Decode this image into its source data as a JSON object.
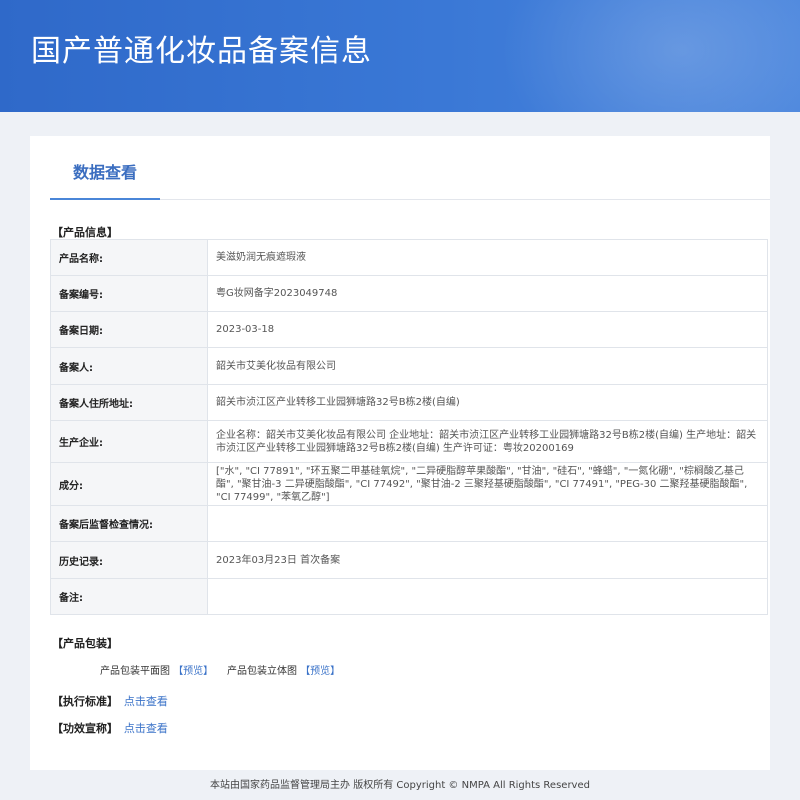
{
  "header": {
    "title": "国产普通化妆品备案信息"
  },
  "tabs": [
    {
      "label": "数据查看"
    }
  ],
  "product_info": {
    "section_title": "【产品信息】",
    "rows": [
      {
        "label": "产品名称:",
        "value": "美滋奶润无痕遮瑕液"
      },
      {
        "label": "备案编号:",
        "value": "粤G妆网备字2023049748"
      },
      {
        "label": "备案日期:",
        "value": "2023-03-18"
      },
      {
        "label": "备案人:",
        "value": "韶关市艾美化妆品有限公司"
      },
      {
        "label": "备案人住所地址:",
        "value": "韶关市浈江区产业转移工业园狮塘路32号B栋2楼(自编)"
      },
      {
        "label": "生产企业:",
        "value": "企业名称：韶关市艾美化妆品有限公司 企业地址：韶关市浈江区产业转移工业园狮塘路32号B栋2楼(自编) 生产地址：韶关市浈江区产业转移工业园狮塘路32号B栋2楼(自编) 生产许可证：粤妆20200169"
      },
      {
        "label": "成分:",
        "value": "[\"水\", \"CI 77891\", \"环五聚二甲基硅氧烷\", \"二异硬脂醇苹果酸酯\", \"甘油\", \"硅石\", \"蜂蜡\", \"一氮化硼\", \"棕榈酸乙基己酯\", \"聚甘油-3 二异硬脂酸酯\", \"CI 77492\", \"聚甘油-2 三聚羟基硬脂酸酯\", \"CI 77491\", \"PEG-30 二聚羟基硬脂酸酯\", \"CI 77499\", \"苯氧乙醇\"]"
      },
      {
        "label": "备案后监督检查情况:",
        "value": ""
      },
      {
        "label": "历史记录:",
        "value": "2023年03月23日 首次备案"
      },
      {
        "label": "备注:",
        "value": ""
      }
    ]
  },
  "packaging": {
    "section_title": "【产品包装】",
    "flat_label": "产品包装平面图",
    "flat_link": "【预览】",
    "solid_label": "产品包装立体图",
    "solid_link": "【预览】"
  },
  "standard": {
    "section_title": "【执行标准】",
    "link": "点击查看"
  },
  "efficacy": {
    "section_title": "【功效宣称】",
    "link": "点击查看"
  },
  "footer": {
    "text": "本站由国家药品监督管理局主办 版权所有 Copyright © NMPA All Rights Reserved"
  }
}
